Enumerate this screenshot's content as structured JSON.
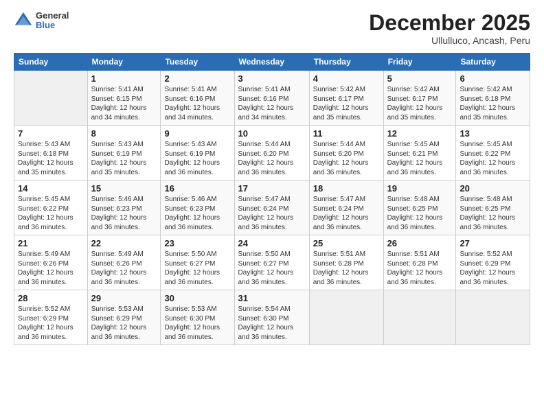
{
  "logo": {
    "general": "General",
    "blue": "Blue"
  },
  "header": {
    "month": "December 2025",
    "location": "Ullulluco, Ancash, Peru"
  },
  "days_of_week": [
    "Sunday",
    "Monday",
    "Tuesday",
    "Wednesday",
    "Thursday",
    "Friday",
    "Saturday"
  ],
  "weeks": [
    [
      {
        "day": "",
        "info": ""
      },
      {
        "day": "1",
        "info": "Sunrise: 5:41 AM\nSunset: 6:15 PM\nDaylight: 12 hours\nand 34 minutes."
      },
      {
        "day": "2",
        "info": "Sunrise: 5:41 AM\nSunset: 6:16 PM\nDaylight: 12 hours\nand 34 minutes."
      },
      {
        "day": "3",
        "info": "Sunrise: 5:41 AM\nSunset: 6:16 PM\nDaylight: 12 hours\nand 34 minutes."
      },
      {
        "day": "4",
        "info": "Sunrise: 5:42 AM\nSunset: 6:17 PM\nDaylight: 12 hours\nand 35 minutes."
      },
      {
        "day": "5",
        "info": "Sunrise: 5:42 AM\nSunset: 6:17 PM\nDaylight: 12 hours\nand 35 minutes."
      },
      {
        "day": "6",
        "info": "Sunrise: 5:42 AM\nSunset: 6:18 PM\nDaylight: 12 hours\nand 35 minutes."
      }
    ],
    [
      {
        "day": "7",
        "info": "Sunrise: 5:43 AM\nSunset: 6:18 PM\nDaylight: 12 hours\nand 35 minutes."
      },
      {
        "day": "8",
        "info": "Sunrise: 5:43 AM\nSunset: 6:19 PM\nDaylight: 12 hours\nand 35 minutes."
      },
      {
        "day": "9",
        "info": "Sunrise: 5:43 AM\nSunset: 6:19 PM\nDaylight: 12 hours\nand 36 minutes."
      },
      {
        "day": "10",
        "info": "Sunrise: 5:44 AM\nSunset: 6:20 PM\nDaylight: 12 hours\nand 36 minutes."
      },
      {
        "day": "11",
        "info": "Sunrise: 5:44 AM\nSunset: 6:20 PM\nDaylight: 12 hours\nand 36 minutes."
      },
      {
        "day": "12",
        "info": "Sunrise: 5:45 AM\nSunset: 6:21 PM\nDaylight: 12 hours\nand 36 minutes."
      },
      {
        "day": "13",
        "info": "Sunrise: 5:45 AM\nSunset: 6:22 PM\nDaylight: 12 hours\nand 36 minutes."
      }
    ],
    [
      {
        "day": "14",
        "info": "Sunrise: 5:45 AM\nSunset: 6:22 PM\nDaylight: 12 hours\nand 36 minutes."
      },
      {
        "day": "15",
        "info": "Sunrise: 5:46 AM\nSunset: 6:23 PM\nDaylight: 12 hours\nand 36 minutes."
      },
      {
        "day": "16",
        "info": "Sunrise: 5:46 AM\nSunset: 6:23 PM\nDaylight: 12 hours\nand 36 minutes."
      },
      {
        "day": "17",
        "info": "Sunrise: 5:47 AM\nSunset: 6:24 PM\nDaylight: 12 hours\nand 36 minutes."
      },
      {
        "day": "18",
        "info": "Sunrise: 5:47 AM\nSunset: 6:24 PM\nDaylight: 12 hours\nand 36 minutes."
      },
      {
        "day": "19",
        "info": "Sunrise: 5:48 AM\nSunset: 6:25 PM\nDaylight: 12 hours\nand 36 minutes."
      },
      {
        "day": "20",
        "info": "Sunrise: 5:48 AM\nSunset: 6:25 PM\nDaylight: 12 hours\nand 36 minutes."
      }
    ],
    [
      {
        "day": "21",
        "info": "Sunrise: 5:49 AM\nSunset: 6:26 PM\nDaylight: 12 hours\nand 36 minutes."
      },
      {
        "day": "22",
        "info": "Sunrise: 5:49 AM\nSunset: 6:26 PM\nDaylight: 12 hours\nand 36 minutes."
      },
      {
        "day": "23",
        "info": "Sunrise: 5:50 AM\nSunset: 6:27 PM\nDaylight: 12 hours\nand 36 minutes."
      },
      {
        "day": "24",
        "info": "Sunrise: 5:50 AM\nSunset: 6:27 PM\nDaylight: 12 hours\nand 36 minutes."
      },
      {
        "day": "25",
        "info": "Sunrise: 5:51 AM\nSunset: 6:28 PM\nDaylight: 12 hours\nand 36 minutes."
      },
      {
        "day": "26",
        "info": "Sunrise: 5:51 AM\nSunset: 6:28 PM\nDaylight: 12 hours\nand 36 minutes."
      },
      {
        "day": "27",
        "info": "Sunrise: 5:52 AM\nSunset: 6:29 PM\nDaylight: 12 hours\nand 36 minutes."
      }
    ],
    [
      {
        "day": "28",
        "info": "Sunrise: 5:52 AM\nSunset: 6:29 PM\nDaylight: 12 hours\nand 36 minutes."
      },
      {
        "day": "29",
        "info": "Sunrise: 5:53 AM\nSunset: 6:29 PM\nDaylight: 12 hours\nand 36 minutes."
      },
      {
        "day": "30",
        "info": "Sunrise: 5:53 AM\nSunset: 6:30 PM\nDaylight: 12 hours\nand 36 minutes."
      },
      {
        "day": "31",
        "info": "Sunrise: 5:54 AM\nSunset: 6:30 PM\nDaylight: 12 hours\nand 36 minutes."
      },
      {
        "day": "",
        "info": ""
      },
      {
        "day": "",
        "info": ""
      },
      {
        "day": "",
        "info": ""
      }
    ]
  ]
}
